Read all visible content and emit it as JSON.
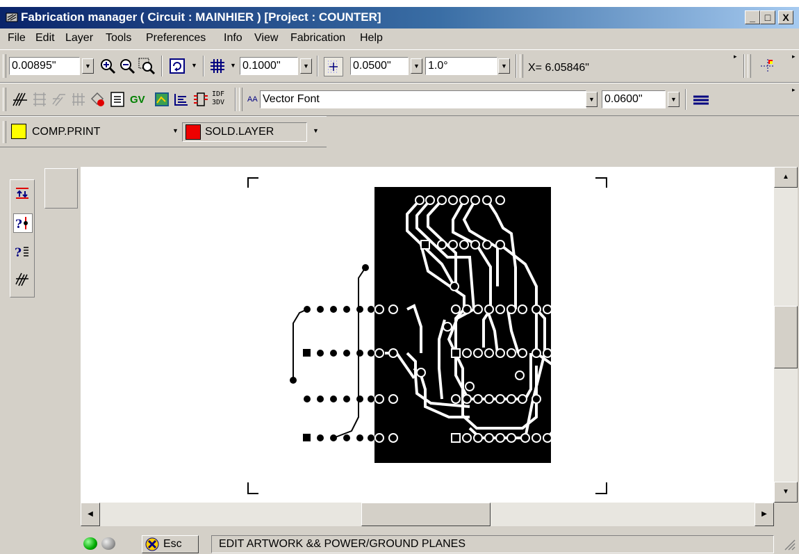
{
  "window": {
    "title": "Fabrication manager ( Circuit : MAINHIER ) [Project : COUNTER]",
    "controls": {
      "minimize": "_",
      "maximize": "□",
      "close": "X"
    }
  },
  "menu": [
    "File",
    "Edit",
    "Layer",
    "Tools",
    "Preferences",
    "Info",
    "View",
    "Fabrication",
    "Help"
  ],
  "toolbar1": {
    "zoom_value": "0.00895\"",
    "grid_spacing": "0.1000\"",
    "snap_value": "0.0500\"",
    "angle_value": "1.0°",
    "coordinate_readout": "X= 6.05846\""
  },
  "toolbar2": {
    "font_prefix": "AA",
    "font_name": "Vector Font",
    "text_height": "0.0600\"",
    "gv_label": "GV",
    "idf_label": "IDF",
    "idf_3dv_label": "3DV"
  },
  "toolbar3": {
    "layer_top": "COMP.PRINT",
    "layer_top_color": "#ffff00",
    "layer_bottom": "SOLD.LAYER",
    "layer_bottom_color": "#ff0000"
  },
  "statusbar": {
    "esc_label": "Esc",
    "message": "EDIT ARTWORK && POWER/GROUND PLANES"
  },
  "colors": {
    "title_start": "#0a246a",
    "title_end": "#a6caf0",
    "board": "#000000",
    "chrome": "#d4d0c8"
  }
}
